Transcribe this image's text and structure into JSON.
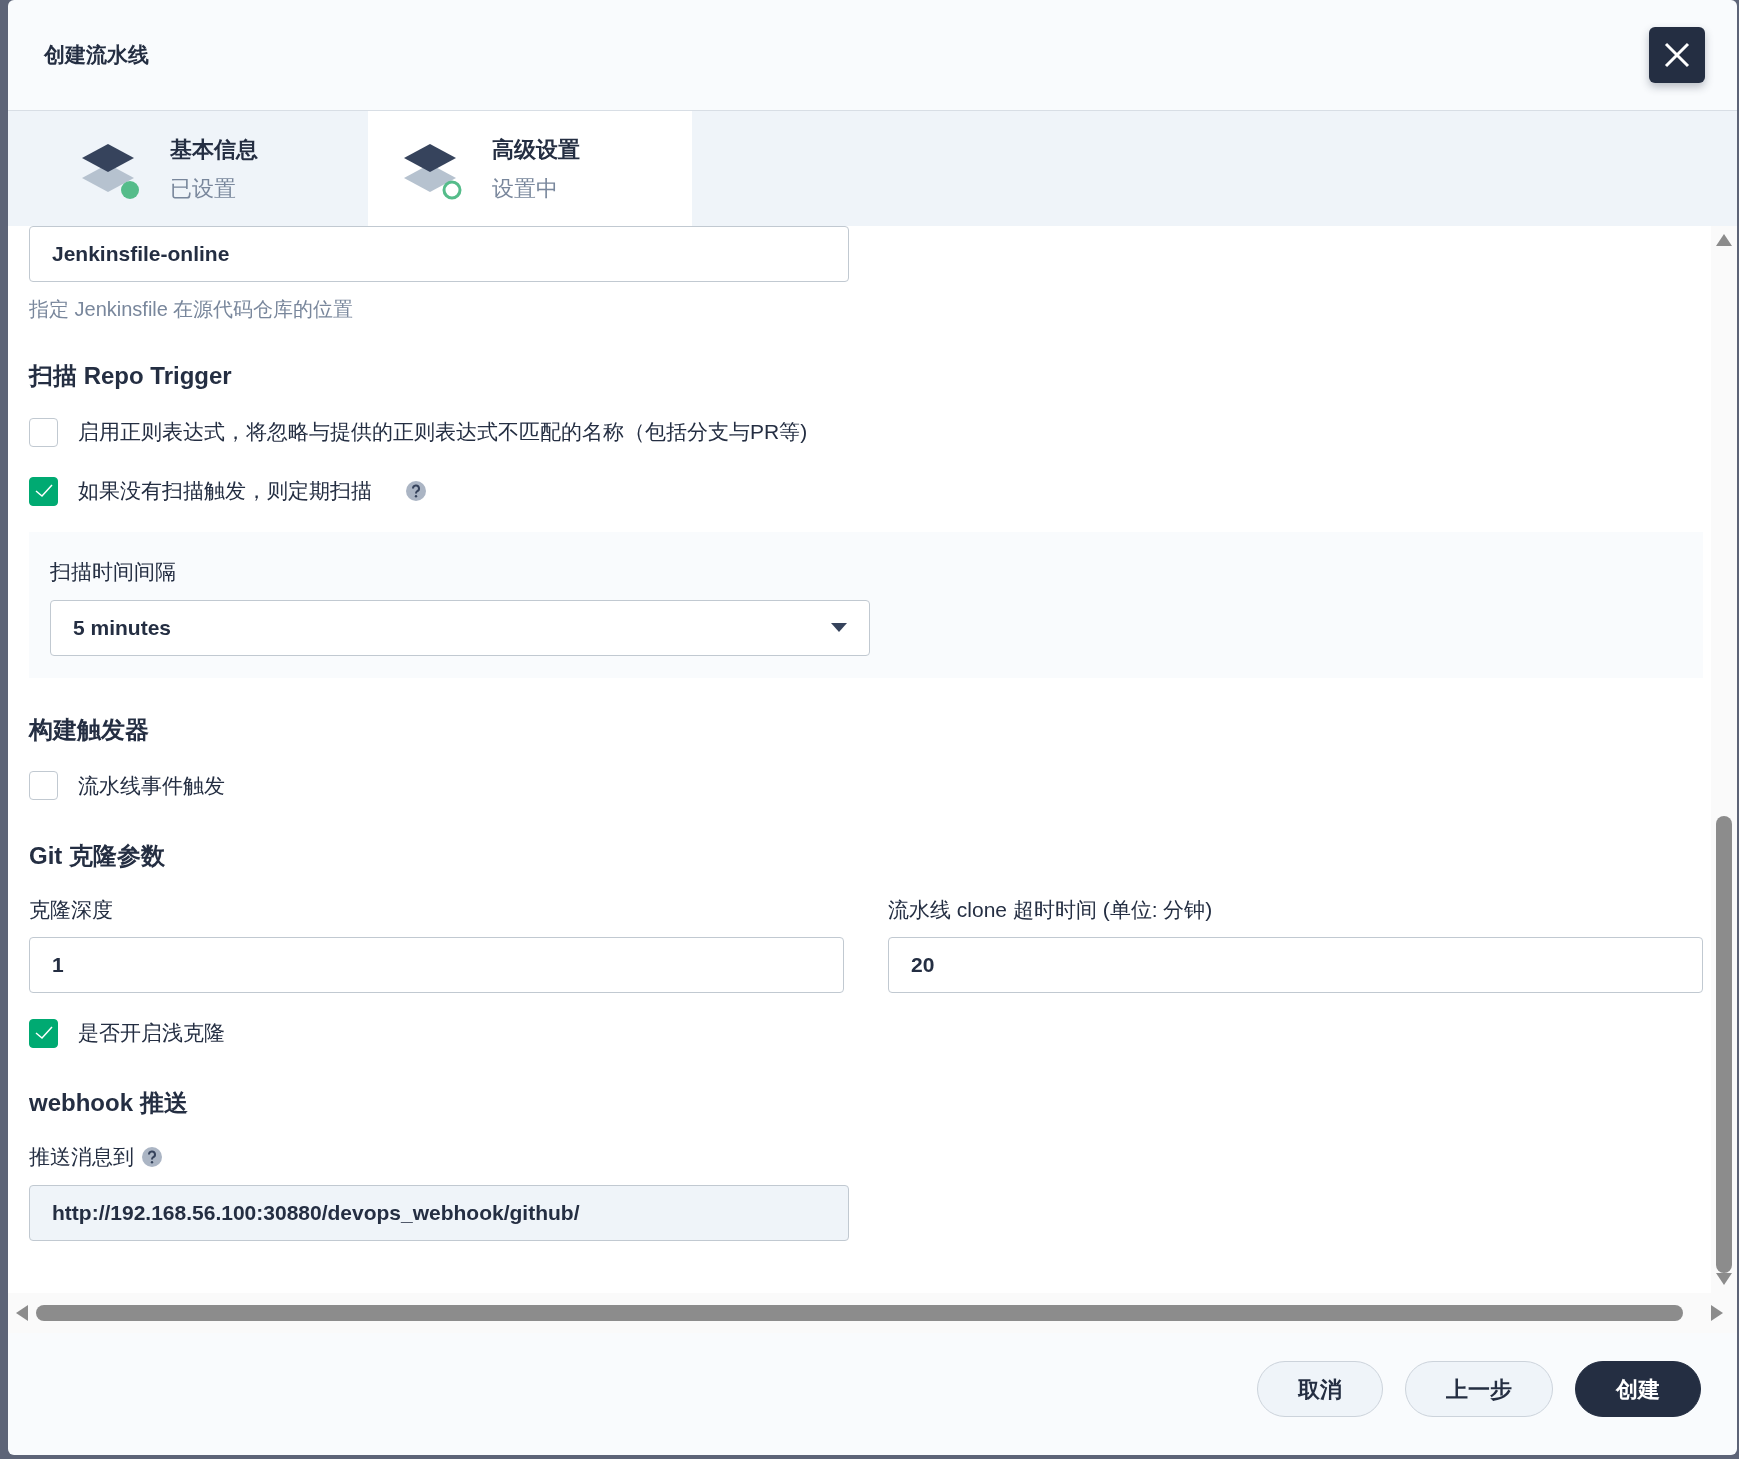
{
  "dialog": {
    "title": "创建流水线"
  },
  "steps": [
    {
      "title": "基本信息",
      "status": "已设置",
      "selected": false,
      "done": true
    },
    {
      "title": "高级设置",
      "status": "设置中",
      "selected": true,
      "done": false
    }
  ],
  "script_path": {
    "value": "Jenkinsfile-online",
    "hint": "指定 Jenkinsfile 在源代码仓库的位置"
  },
  "scan_trigger": {
    "heading": "扫描 Repo Trigger",
    "options": [
      {
        "label": "启用正则表达式，将忽略与提供的正则表达式不匹配的名称（包括分支与PR等)",
        "checked": false,
        "help": false
      },
      {
        "label": "如果没有扫描触发，则定期扫描",
        "checked": true,
        "help": true
      }
    ],
    "interval": {
      "label": "扫描时间间隔",
      "value": "5 minutes"
    }
  },
  "build_trigger": {
    "heading": "构建触发器",
    "options": [
      {
        "label": "流水线事件触发",
        "checked": false
      }
    ]
  },
  "git_clone": {
    "heading": "Git 克隆参数",
    "fields": [
      {
        "label": "克隆深度",
        "value": "1"
      },
      {
        "label": "流水线 clone 超时时间 (单位: 分钟)",
        "value": "20"
      }
    ],
    "options": [
      {
        "label": "是否开启浅克隆",
        "checked": true
      }
    ]
  },
  "webhook": {
    "heading": "webhook 推送",
    "label": "推送消息到",
    "help": true,
    "value": "http://192.168.56.100:30880/devops_webhook/github/"
  },
  "buttons": [
    {
      "label": "取消",
      "kind": "secondary"
    },
    {
      "label": "上一步",
      "kind": "secondary"
    },
    {
      "label": "创建",
      "kind": "primary"
    }
  ]
}
